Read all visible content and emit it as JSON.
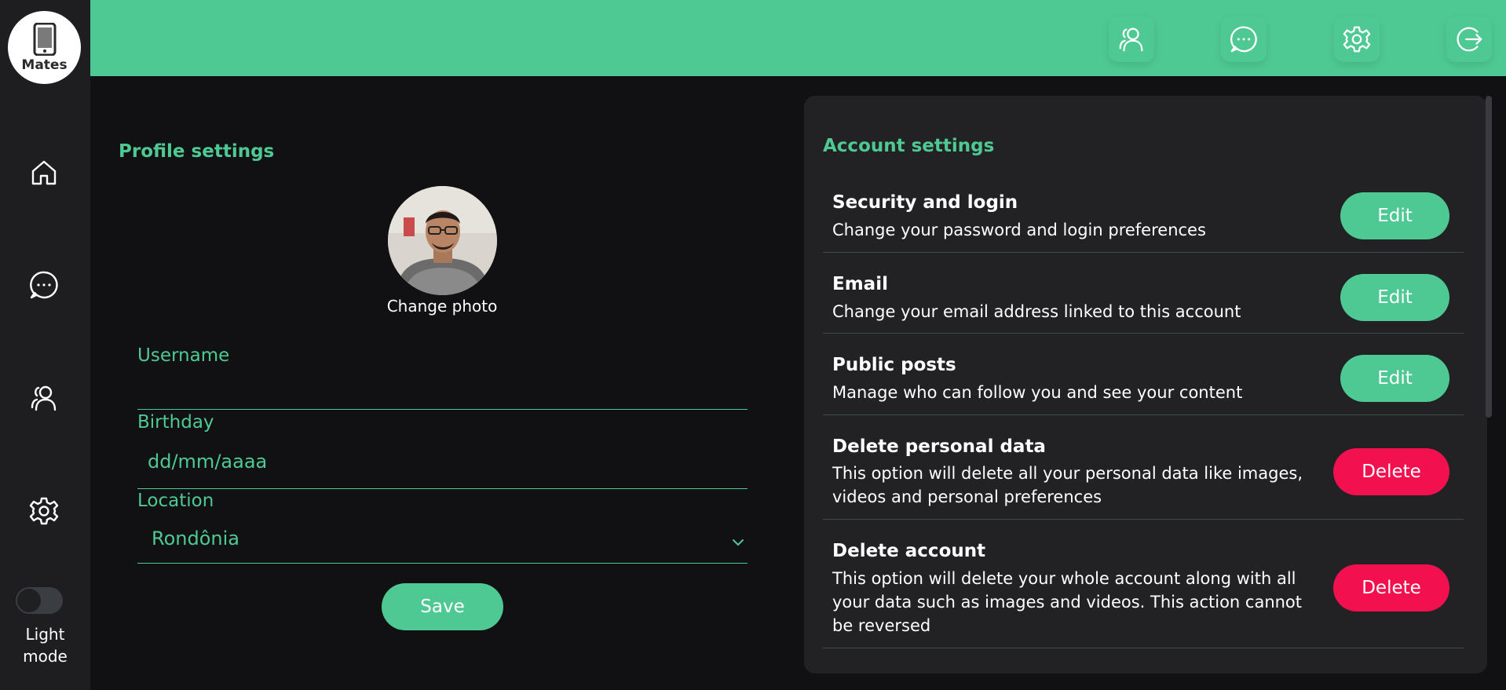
{
  "app": {
    "logo_text": "Mates",
    "theme_toggle_label_line1": "Light",
    "theme_toggle_label_line2": "mode",
    "theme_toggle_on": false
  },
  "sidebar": {
    "items": [
      {
        "icon": "home-icon"
      },
      {
        "icon": "chat-icon"
      },
      {
        "icon": "users-icon"
      },
      {
        "icon": "gear-icon"
      }
    ]
  },
  "topbar": {
    "items": [
      {
        "icon": "users-icon"
      },
      {
        "icon": "chat-icon"
      },
      {
        "icon": "gear-icon"
      },
      {
        "icon": "logout-icon"
      }
    ]
  },
  "profile": {
    "title": "Profile settings",
    "change_photo": "Change photo",
    "username_label": "Username",
    "username_value": "",
    "birthday_label": "Birthday",
    "birthday_placeholder": "dd/mm/aaaa",
    "location_label": "Location",
    "location_value": "Rondônia",
    "save_label": "Save"
  },
  "account": {
    "title": "Account settings",
    "rows": [
      {
        "title": "Security and login",
        "desc_lines": [
          "Change your password and login preferences"
        ],
        "action": "Edit"
      },
      {
        "title": "Email",
        "desc_lines": [
          "Change your email address linked to this account"
        ],
        "action": "Edit"
      },
      {
        "title": "Public posts",
        "desc_lines": [
          "Manage who can follow you and see your content"
        ],
        "action": "Edit"
      },
      {
        "title": "Delete personal data",
        "desc_lines": [
          "This option will delete all your personal data like images,",
          "videos and personal preferences"
        ],
        "action": "Delete"
      },
      {
        "title": "Delete account",
        "desc_lines": [
          "This option will delete your whole account along with all",
          "your data such as images and videos. This action cannot",
          "be reversed"
        ],
        "action": "Delete"
      }
    ]
  },
  "colors": {
    "accent": "#4fc993",
    "danger": "#f3104f",
    "background": "#111113",
    "panel": "#222225",
    "sidebar": "#1e1e21"
  }
}
